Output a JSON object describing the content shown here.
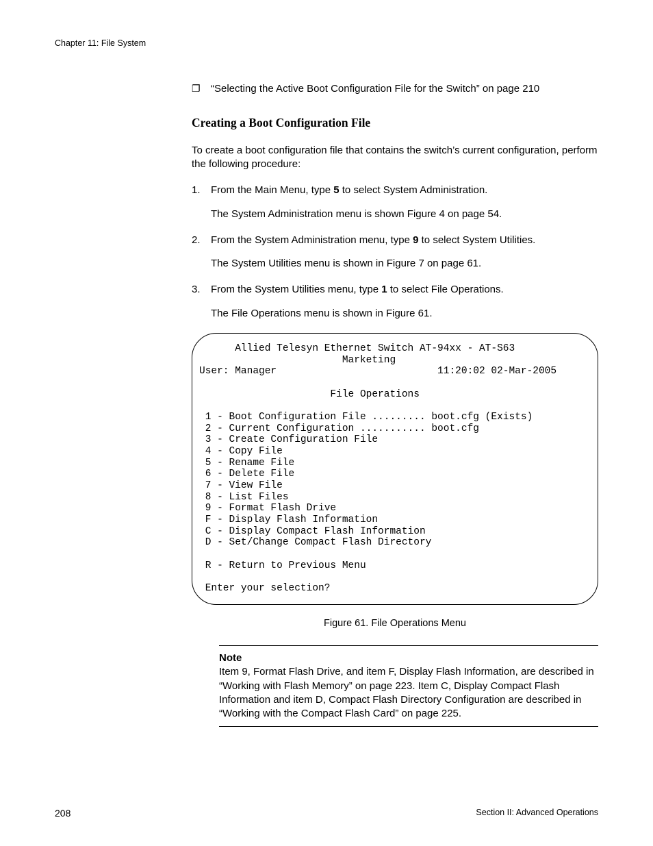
{
  "header": {
    "chapter": "Chapter 11: File System"
  },
  "bullet": {
    "glyph": "❐",
    "text": "“Selecting the Active Boot Configuration File for the Switch” on page 210"
  },
  "heading": "Creating a Boot Configuration File",
  "intro": "To create a boot configuration file that contains the switch’s current configuration, perform the following procedure:",
  "steps": {
    "s1": {
      "num": "1.",
      "pre": "From the Main Menu, type ",
      "bold": "5",
      "post": " to select System Administration.",
      "sub": "The System Administration menu is shown Figure 4 on page 54."
    },
    "s2": {
      "num": "2.",
      "pre": "From the System Administration menu, type ",
      "bold": "9",
      "post": " to select System Utilities.",
      "sub": "The System Utilities menu is shown in Figure 7 on page 61."
    },
    "s3": {
      "num": "3.",
      "pre": "From the System Utilities menu, type ",
      "bold": "1",
      "post": " to select File Operations.",
      "sub": "The File Operations menu is shown in Figure 61."
    }
  },
  "terminal": "      Allied Telesyn Ethernet Switch AT-94xx - AT-S63\n                        Marketing\nUser: Manager                           11:20:02 02-Mar-2005\n\n                      File Operations\n\n 1 - Boot Configuration File ......... boot.cfg (Exists)\n 2 - Current Configuration ........... boot.cfg\n 3 - Create Configuration File\n 4 - Copy File\n 5 - Rename File\n 6 - Delete File\n 7 - View File\n 8 - List Files\n 9 - Format Flash Drive\n F - Display Flash Information\n C - Display Compact Flash Information\n D - Set/Change Compact Flash Directory\n\n R - Return to Previous Menu\n\n Enter your selection?",
  "figure_caption": "Figure 61. File Operations Menu",
  "note": {
    "label": "Note",
    "body": "Item 9, Format Flash Drive, and item F, Display Flash Information, are described in “Working with Flash Memory” on page 223. Item C, Display Compact Flash Information and item D, Compact Flash Directory Configuration are described in “Working with the Compact Flash Card” on page 225."
  },
  "footer": {
    "page": "208",
    "section": "Section II: Advanced Operations"
  }
}
